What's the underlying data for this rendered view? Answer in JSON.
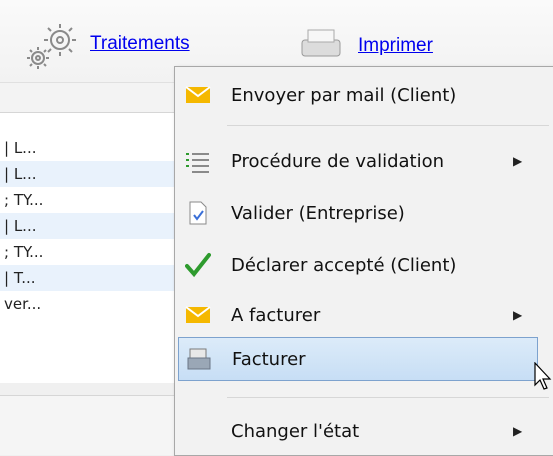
{
  "toolbar": {
    "traitements_label": "Traitements",
    "imprimer_label": "Imprimer"
  },
  "grid_rows": [
    "| L...",
    "| L...",
    "; TY...",
    "| L...",
    "; TY...",
    "| T...",
    "ver..."
  ],
  "menu": {
    "items": [
      {
        "label": "Envoyer par mail (Client)",
        "icon": "envelope-icon"
      },
      {
        "label": "Procédure de validation",
        "icon": "list-icon",
        "submenu": true
      },
      {
        "label": "Valider (Entreprise)",
        "icon": "document-check-icon"
      },
      {
        "label": "Déclarer accepté (Client)",
        "icon": "checkmark-icon"
      },
      {
        "label": "A facturer",
        "icon": "envelope-icon",
        "submenu": true
      },
      {
        "label": "Facturer",
        "icon": "invoice-icon",
        "highlighted": true
      },
      {
        "label": "Changer l'état",
        "icon": "",
        "submenu": true
      }
    ]
  },
  "colors": {
    "link": "#0000ee",
    "highlight_border": "#7da2ce",
    "envelope": "#f5b800",
    "check": "#2e9b2e"
  }
}
